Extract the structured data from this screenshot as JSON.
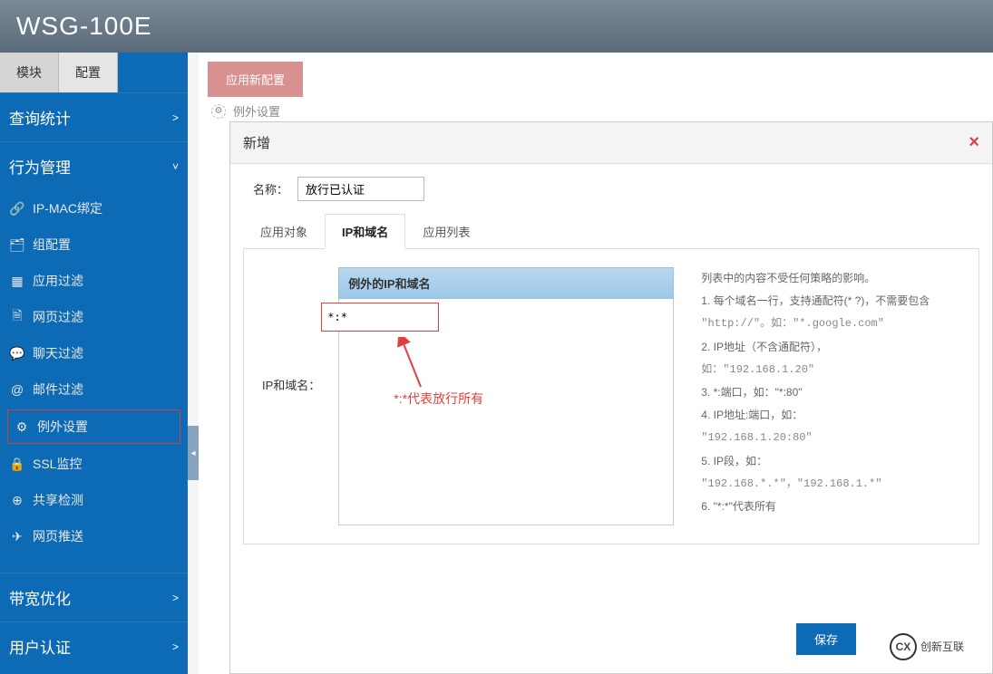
{
  "header": {
    "title": "WSG-100E"
  },
  "sidebar": {
    "tabs": [
      {
        "label": "模块",
        "active": true
      },
      {
        "label": "配置",
        "active": false
      }
    ],
    "sections": [
      {
        "label": "查询统计",
        "chevron": ">",
        "expanded": false
      },
      {
        "label": "行为管理",
        "chevron": "˅",
        "expanded": true
      },
      {
        "label": "带宽优化",
        "chevron": ">",
        "expanded": false
      },
      {
        "label": "用户认证",
        "chevron": ">",
        "expanded": false
      }
    ],
    "menu_items": [
      {
        "label": "IP-MAC绑定",
        "icon": "link"
      },
      {
        "label": "组配置",
        "icon": "card"
      },
      {
        "label": "应用过滤",
        "icon": "grid"
      },
      {
        "label": "网页过滤",
        "icon": "doc"
      },
      {
        "label": "聊天过滤",
        "icon": "chat"
      },
      {
        "label": "邮件过滤",
        "icon": "mail"
      },
      {
        "label": "例外设置",
        "icon": "gear",
        "active": true
      },
      {
        "label": "SSL监控",
        "icon": "lock"
      },
      {
        "label": "共享检测",
        "icon": "share"
      },
      {
        "label": "网页推送",
        "icon": "send"
      }
    ]
  },
  "main": {
    "apply_button": "应用新配置",
    "breadcrumb": "例外设置"
  },
  "modal": {
    "title": "新增",
    "name_label": "名称：",
    "name_value": "放行已认证",
    "tabs": [
      {
        "label": "应用对象"
      },
      {
        "label": "IP和域名"
      },
      {
        "label": "应用列表"
      }
    ],
    "ip_section": {
      "row_label": "IP和域名：",
      "header": "例外的IP和域名",
      "value": "*:*",
      "annotation": "*:*代表放行所有"
    },
    "help_lines": [
      "列表中的内容不受任何策略的影响。",
      "1. 每个域名一行，支持通配符(* ?)，不需要包含",
      "\"http://\"。如：\"*.google.com\"",
      "2. IP地址（不含通配符），",
      "如：\"192.168.1.20\"",
      "3. *:端口，如：\"*:80\"",
      "4. IP地址:端口，如：",
      "\"192.168.1.20:80\"",
      "5. IP段，如：",
      "\"192.168.*.*\"，\"192.168.1.*\"",
      "6. \"*:*\"代表所有"
    ],
    "save_button": "保存"
  },
  "watermark": {
    "logo": "CX",
    "text": "创新互联"
  }
}
